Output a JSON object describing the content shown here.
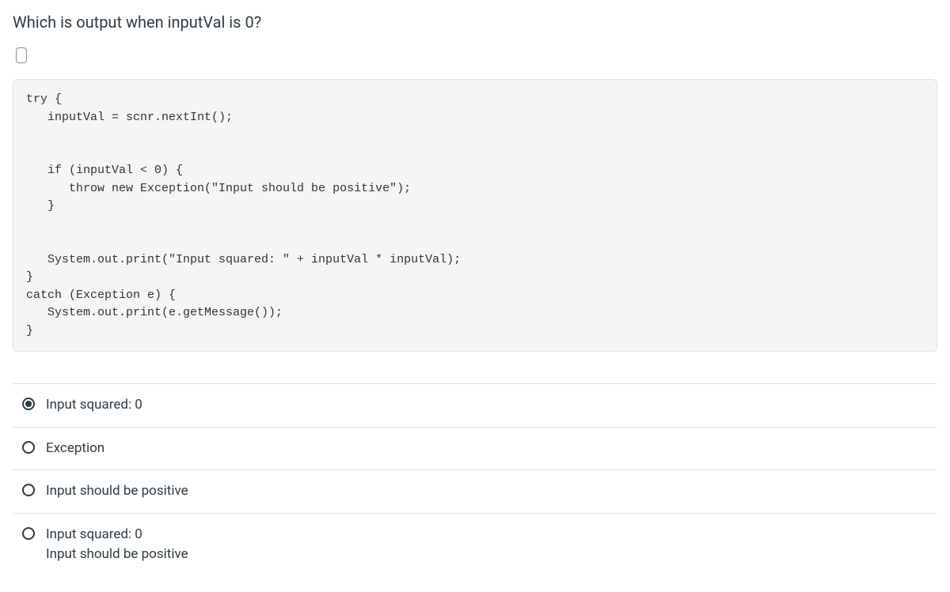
{
  "question": {
    "prompt": "Which is output when inputVal is 0?",
    "code": "try {\n   inputVal = scnr.nextInt();\n\n\n   if (inputVal < 0) {\n      throw new Exception(\"Input should be positive\");\n   }\n\n\n   System.out.print(\"Input squared: \" + inputVal * inputVal);\n}\ncatch (Exception e) {\n   System.out.print(e.getMessage());\n}"
  },
  "answers": [
    {
      "label": "Input squared: 0",
      "selected": true
    },
    {
      "label": "Exception",
      "selected": false
    },
    {
      "label": "Input should be positive",
      "selected": false
    },
    {
      "label": "Input squared: 0\nInput should be positive",
      "selected": false
    }
  ]
}
